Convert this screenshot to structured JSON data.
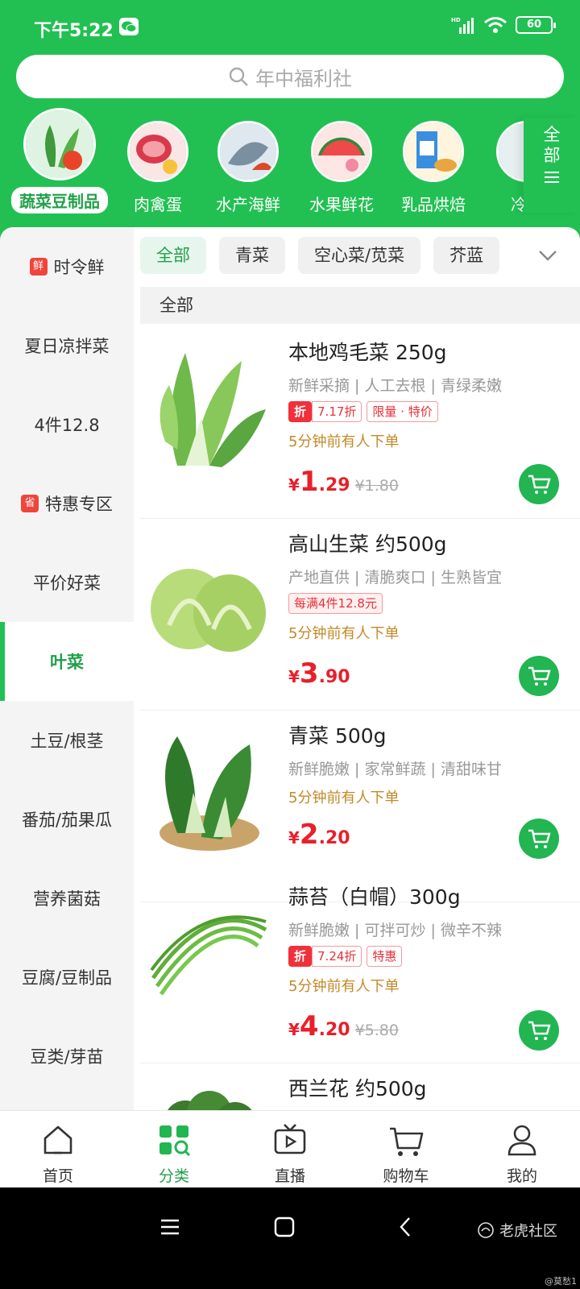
{
  "status_bar": {
    "time": "下午5:22",
    "battery": "60",
    "network": "HD"
  },
  "search": {
    "placeholder": "年中福利社"
  },
  "categories": [
    {
      "label": "蔬菜豆制品",
      "active": true
    },
    {
      "label": "肉禽蛋"
    },
    {
      "label": "水产海鲜"
    },
    {
      "label": "水果鲜花"
    },
    {
      "label": "乳品烘焙"
    },
    {
      "label": "冷冻"
    }
  ],
  "categories_more": {
    "line1": "全",
    "line2": "部"
  },
  "left_nav": [
    {
      "label": "时令鲜",
      "badge": "鲜"
    },
    {
      "label": "夏日凉拌菜"
    },
    {
      "label": "4件12.8"
    },
    {
      "label": "特惠专区",
      "badge": "省"
    },
    {
      "label": "平价好菜"
    },
    {
      "label": "叶菜",
      "active": true
    },
    {
      "label": "土豆/根茎"
    },
    {
      "label": "番茄/茄果瓜"
    },
    {
      "label": "营养菌菇"
    },
    {
      "label": "豆腐/豆制品"
    },
    {
      "label": "豆类/芽苗"
    }
  ],
  "filter_chips": [
    {
      "label": "全部",
      "active": true
    },
    {
      "label": "青菜"
    },
    {
      "label": "空心菜/苋菜"
    },
    {
      "label": "芥蓝"
    }
  ],
  "section_title": "全部",
  "products": [
    {
      "name": "本地鸡毛菜 250g",
      "desc": "新鲜采摘 | 人工去根 | 青绿柔嫩",
      "tags": [
        "折",
        "7.17折",
        "限量 · 特价"
      ],
      "recent": "5分钟前有人下单",
      "price_int": "1",
      "price_dec": ".29",
      "original": "¥1.80"
    },
    {
      "name": "高山生菜 约500g",
      "desc": "产地直供 | 清脆爽口 | 生熟皆宜",
      "tags": [
        "每满4件12.8元"
      ],
      "recent": "5分钟前有人下单",
      "price_int": "3",
      "price_dec": ".90",
      "original": ""
    },
    {
      "name": "青菜 500g",
      "desc": "新鲜脆嫩 | 家常鲜蔬 | 清甜味甘",
      "tags": [],
      "recent": "5分钟前有人下单",
      "price_int": "2",
      "price_dec": ".20",
      "original": ""
    },
    {
      "name": "蒜苔（白帽）300g",
      "desc": "新鲜脆嫩 | 可拌可炒 | 微辛不辣",
      "tags": [
        "折",
        "7.24折",
        "特惠"
      ],
      "recent": "5分钟前有人下单",
      "price_int": "4",
      "price_dec": ".20",
      "original": "¥5.80"
    },
    {
      "name": "西兰花 约500g"
    }
  ],
  "currency": "¥",
  "tabbar": [
    {
      "label": "首页",
      "icon": "home-icon"
    },
    {
      "label": "分类",
      "icon": "category-icon",
      "active": true
    },
    {
      "label": "直播",
      "icon": "live-tv-icon"
    },
    {
      "label": "购物车",
      "icon": "cart-icon"
    },
    {
      "label": "我的",
      "icon": "profile-icon"
    }
  ],
  "watermark": {
    "main": "老虎社区",
    "sub": "@莫愁1"
  },
  "colors": {
    "brand_green": "#22c053",
    "price_red": "#e8202a",
    "promo_gold": "#c28a28"
  }
}
